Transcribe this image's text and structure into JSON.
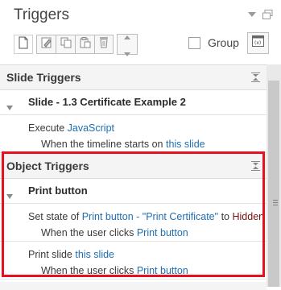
{
  "window": {
    "title": "Triggers"
  },
  "toolbar": {
    "group_label": "Group"
  },
  "sections": [
    {
      "title": "Slide Triggers",
      "slide": {
        "label": "Slide - 1.3 Certificate Example 2"
      },
      "triggers": [
        {
          "line1": {
            "action": "Execute",
            "target": "JavaScript"
          },
          "line2": {
            "prefix": "When the",
            "event": "timeline starts",
            "mid": "on",
            "object": "this slide"
          }
        }
      ]
    },
    {
      "title": "Object Triggers",
      "slide": {
        "label": "Print button"
      },
      "triggers": [
        {
          "line1": {
            "action": "Set state of",
            "target": "Print button - \"Print Certificate\"",
            "mid": "to",
            "value": "Hidden"
          },
          "line2": {
            "prefix": "When the",
            "event": "user clicks",
            "object": "Print button"
          }
        },
        {
          "line1": {
            "action": "Print slide",
            "target": "this slide"
          },
          "line2": {
            "prefix": "When the",
            "event": "user clicks",
            "object": "Print button"
          }
        }
      ]
    }
  ],
  "colors": {
    "link": "#1f6fb2",
    "value": "#7a1010",
    "highlight": "#e8101f"
  }
}
